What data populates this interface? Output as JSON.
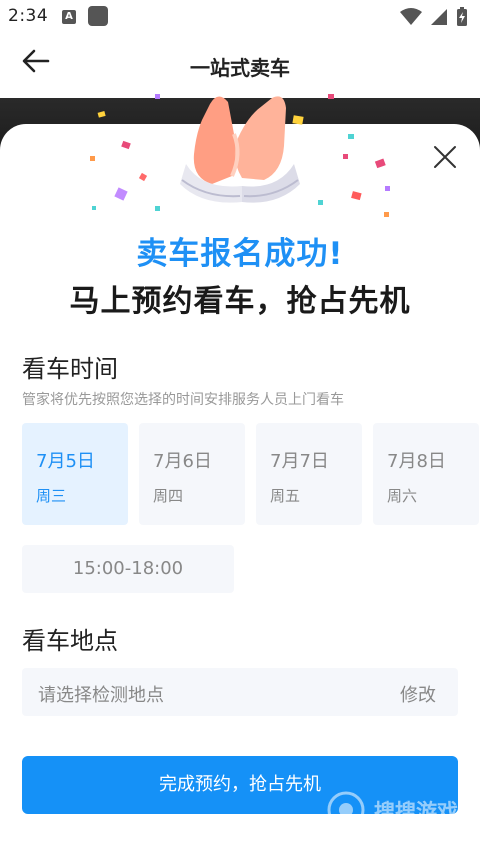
{
  "status_bar": {
    "time": "2:34",
    "notification_letter": "A"
  },
  "header": {
    "title": "一站式卖车"
  },
  "success": {
    "title": "卖车报名成功!",
    "subtitle": "马上预约看车，抢占先机"
  },
  "viewing_time": {
    "section_title": "看车时间",
    "description": "管家将优先按照您选择的时间安排服务人员上门看车",
    "dates": [
      {
        "day": "7月5日",
        "weekday": "周三",
        "selected": true
      },
      {
        "day": "7月6日",
        "weekday": "周四",
        "selected": false
      },
      {
        "day": "7月7日",
        "weekday": "周五",
        "selected": false
      },
      {
        "day": "7月8日",
        "weekday": "周六",
        "selected": false
      }
    ],
    "time_slot": "15:00-18:00"
  },
  "viewing_location": {
    "section_title": "看车地点",
    "placeholder": "请选择检测地点",
    "edit_label": "修改"
  },
  "submit_label": "完成预约，抢占先机",
  "watermark_text": "搜搜游戏",
  "colors": {
    "accent": "#1e90f5",
    "button": "#1591f7",
    "card_bg": "#f5f7fb",
    "selected_bg": "#e5f2ff"
  }
}
